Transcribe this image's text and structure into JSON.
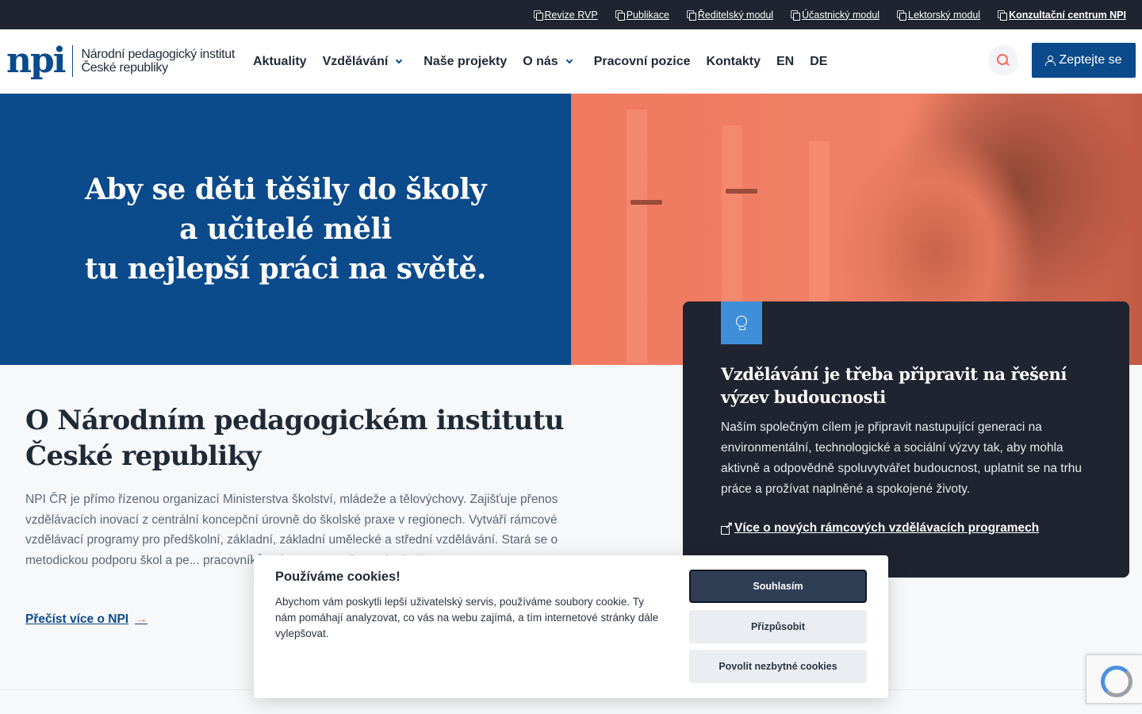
{
  "topbar": {
    "links": [
      {
        "label": "Revize RVP",
        "strong": false
      },
      {
        "label": "Publikace",
        "strong": false
      },
      {
        "label": "Ředitelský modul",
        "strong": false
      },
      {
        "label": "Účastnický modul",
        "strong": false
      },
      {
        "label": "Lektorský modul",
        "strong": false
      },
      {
        "label": "Konzultační centrum NPI",
        "strong": true
      }
    ]
  },
  "header": {
    "logo_mark": "npi",
    "logo_line1": "Národní pedagogický institut",
    "logo_line2": "České republiky",
    "nav": [
      "Aktuality",
      "Vzdělávání",
      "Naše projekty",
      "O nás",
      "Pracovní pozice",
      "Kontakty",
      "EN",
      "DE"
    ],
    "ask_label": "Zeptejte se"
  },
  "hero": {
    "line1": "Aby se děti těšily do školy",
    "line2": "a učitelé měli",
    "line3": "tu nejlepší práci na světě."
  },
  "card": {
    "title": "Vzdělávání je třeba připravit na řešení výzev budoucnosti",
    "text": "Naším společným cílem je připravit nastupující generaci na environmentální, technologické a sociální výzvy tak, aby mohla aktivně a odpovědně spoluvytvářet budoucnost, uplatnit se na trhu práce a prožívat naplněné a spokojené životy.",
    "link": "Více o nových rámcových vzdělávacích programech"
  },
  "about": {
    "title_line1": "O Národním pedagogickém institutu",
    "title_line2": "České republiky",
    "text": "NPI ČR je přímo řízenou organizací Ministerstva školství, mládeže a tělovýchovy. Zajišťuje přenos vzdělávacích inovací z centrální koncepční úrovně do školské praxe v regionech. Vytváří rámcové vzdělávací programy pro předškolní, základní, základní umělecké a střední vzdělávání. Stará se o metodickou podporu škol a pe... pracovníků. Významnou roli v podpoře šk...",
    "link": "Přečíst více o NPI"
  },
  "cookie": {
    "title": "Používáme cookies!",
    "text": "Abychom vám poskytli lepší uživatelský servis, používáme soubory cookie. Ty nám pomáhají analyzovat, co vás na webu zajímá, a tím internetové stránky dále vylepšovat.",
    "accept": "Souhlasím",
    "customize": "Přizpůsobit",
    "necessary": "Povolit nezbytné cookies"
  },
  "colors": {
    "brand_blue": "#0b4a8b",
    "dark": "#1f2430",
    "accent_orange": "#ef6c57",
    "bulb_blue": "#3e8fd8"
  }
}
